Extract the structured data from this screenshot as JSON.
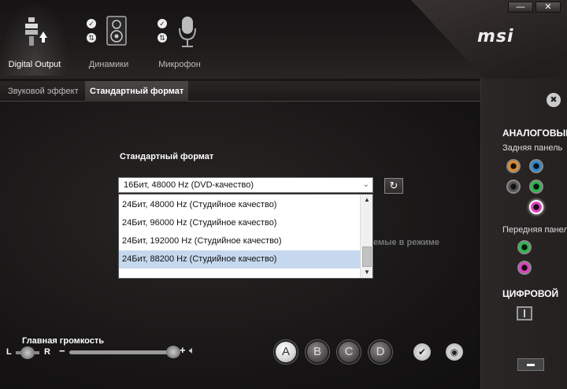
{
  "window": {
    "minimize_label": "—",
    "close_label": "✕"
  },
  "brand": {
    "logo": "msi"
  },
  "device_tabs": [
    {
      "label": "Digital Output",
      "active": true,
      "icon": "digital-plug-icon"
    },
    {
      "label": "Динамики",
      "active": false,
      "icon": "speaker-icon"
    },
    {
      "label": "Микрофон",
      "active": false,
      "icon": "microphone-icon"
    }
  ],
  "sub_tabs": [
    {
      "label": "Звуковой эффект",
      "active": false
    },
    {
      "label": "Стандартный формат",
      "active": true
    }
  ],
  "format": {
    "title": "Стандартный формат",
    "selected": "16Бит, 48000 Hz (DVD-качество)",
    "options": [
      "24Бит, 48000 Hz (Студийное качество)",
      "24Бит, 96000 Hz (Студийное качество)",
      "24Бит, 192000 Hz (Студийное качество)",
      "24Бит, 88200 Hz (Студийное качество)"
    ],
    "hovered_index": 3,
    "partial_hidden_text": "емые в режиме"
  },
  "right_panel": {
    "analog_title": "АНАЛОГОВЫЙ",
    "rear_panel": "Задняя панель",
    "front_panel": "Передняя панель",
    "digital_title": "ЦИФРОВОЙ",
    "rear_jacks": [
      "#e08a2a",
      "#2a8ad0",
      "#555555",
      "#2ab84a",
      "#e040c0"
    ],
    "front_jacks": [
      "#2ab84a",
      "#e040c0"
    ],
    "active_rear_jack_index": 4
  },
  "volume": {
    "title": "Главная громкость",
    "left": "L",
    "right": "R",
    "minus": "−",
    "plus": "+",
    "level_percent": 100
  },
  "presets": [
    "A",
    "B",
    "C",
    "D"
  ],
  "active_preset": "A"
}
